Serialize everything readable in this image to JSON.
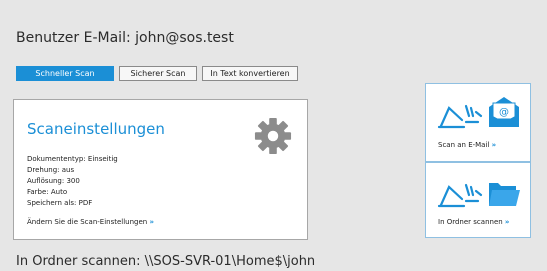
{
  "header": {
    "user_label": "Benutzer E-Mail:",
    "user_email": "john@sos.test"
  },
  "tabs": [
    {
      "label": "Schneller Scan",
      "active": true
    },
    {
      "label": "Sicherer Scan",
      "active": false
    },
    {
      "label": "In Text konvertieren",
      "active": false
    }
  ],
  "settings": {
    "title": "Scaneinstellungen",
    "icon": "gear-icon",
    "lines": [
      "Dokumententyp: Einseitig",
      "Drehung: aus",
      "Auflösung: 300",
      "Farbe: Auto",
      "Speichern als: PDF"
    ],
    "change_link": "Ändern Sie die Scan-Einstellungen",
    "chevron": "»"
  },
  "actions": {
    "email": {
      "label": "Scan an E-Mail",
      "chevron": "»",
      "icon": "scanner-email-icon"
    },
    "folder": {
      "label": "In Ordner scannen",
      "chevron": "»",
      "icon": "scanner-folder-icon"
    }
  },
  "footer": {
    "scan_path": "In Ordner scannen: \\\\SOS-SVR-01\\Home$\\john"
  },
  "colors": {
    "accent": "#1b8fd6",
    "background": "#e6e6e6",
    "card": "#ffffff"
  }
}
